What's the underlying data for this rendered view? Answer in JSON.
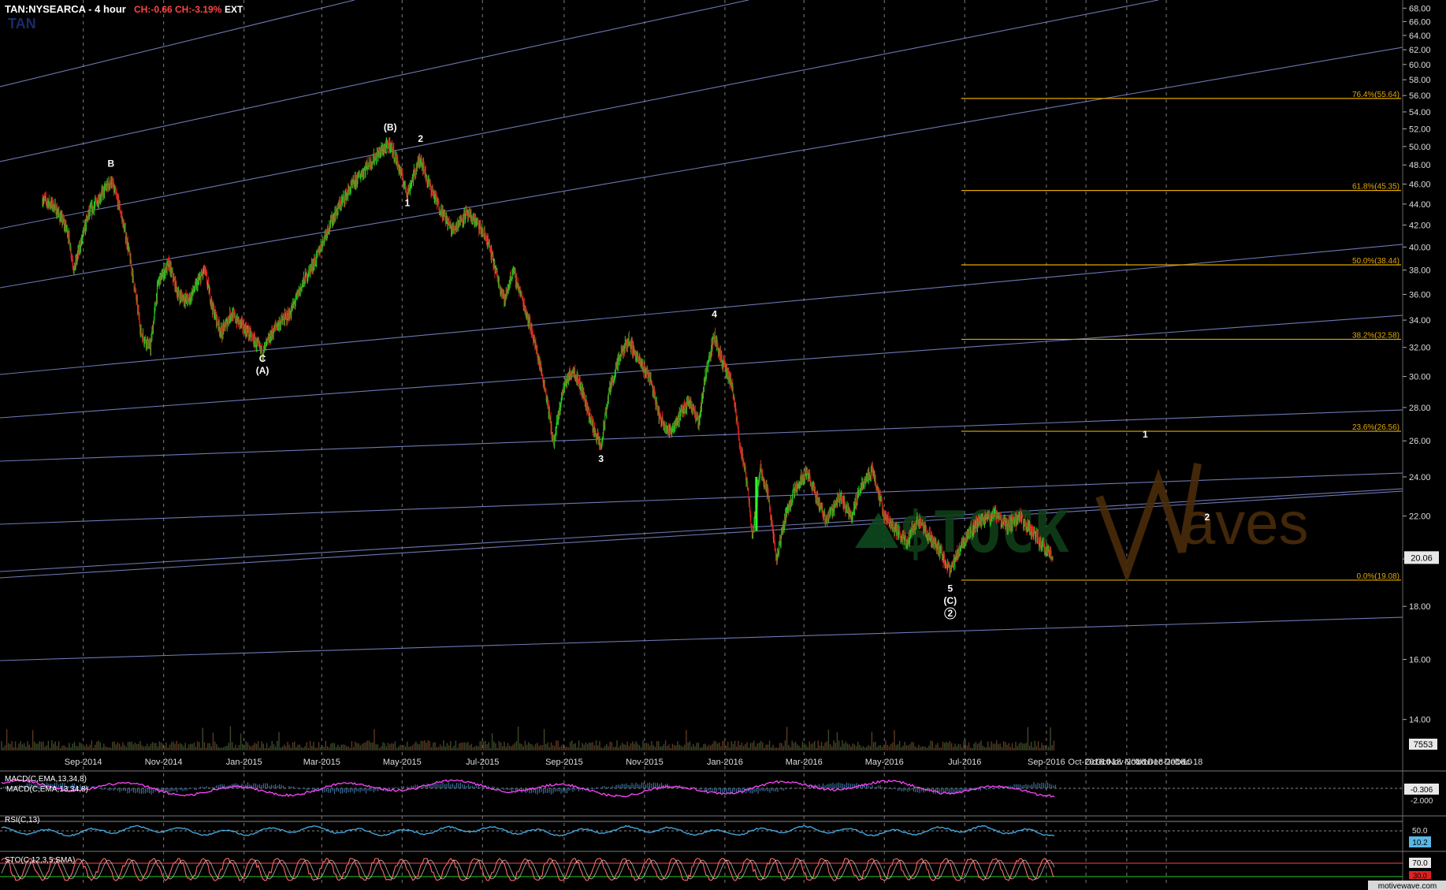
{
  "header": {
    "symbol": "TAN:NYSEARCA - 4 hour",
    "change": "CH:-0.66",
    "change_pct": "CH:-3.19%",
    "session": "EXT",
    "sub": "TAN"
  },
  "watermark": {
    "stock": "$TOCK",
    "waves": "Waves"
  },
  "footer": {
    "credit": "motivewave.com"
  },
  "colors": {
    "up": "#22cc22",
    "down": "#dd2222",
    "fib": "#e0a800",
    "channel": "#7a86c8",
    "macd": "#ff44ff",
    "signal": "#5ab8e8",
    "rsi": "#46aee8",
    "stoch_k": "#ff6a6a",
    "stoch_d": "#ffffff"
  },
  "chart_data": {
    "type": "candlestick",
    "symbol": "TAN",
    "timeframe": "4 hour",
    "y_scale": "log",
    "ylim": [
      13,
      69
    ],
    "y_ticks": [
      "14.00",
      "16.00",
      "18.00",
      "20.00",
      "22.00",
      "24.00",
      "26.00",
      "28.00",
      "30.00",
      "32.00",
      "34.00",
      "36.00",
      "38.00",
      "40.00",
      "42.00",
      "44.00",
      "46.00",
      "48.00",
      "50.00",
      "52.00",
      "54.00",
      "56.00",
      "58.00",
      "60.00",
      "62.00",
      "64.00",
      "66.00",
      "68.00"
    ],
    "last_price": "20.06",
    "volume_label": "7553",
    "x_ticks": [
      "Sep-2014",
      "Nov-2014",
      "Jan-2015",
      "Mar-2015",
      "May-2015",
      "Jul-2015",
      "Sep-2015",
      "Nov-2015",
      "Jan-2016",
      "Mar-2016",
      "May-2016",
      "Jul-2016",
      "Sep-2016",
      "Oct-2016",
      "Oct-10",
      "Oct-18",
      "Nov-2016",
      "Nov-10",
      "Nov-18",
      "Dec-2016",
      "Dec-10",
      "Dec-18"
    ],
    "price_path": [
      [
        "2014-08-01",
        44.5
      ],
      [
        "2014-08-10",
        43.8
      ],
      [
        "2014-08-20",
        41.5
      ],
      [
        "2014-08-25",
        38.0
      ],
      [
        "2014-09-05",
        43.0
      ],
      [
        "2014-09-15",
        45.0
      ],
      [
        "2014-09-22",
        46.3
      ],
      [
        "2014-09-28",
        44.0
      ],
      [
        "2014-10-05",
        40.0
      ],
      [
        "2014-10-15",
        33.0
      ],
      [
        "2014-10-22",
        32.0
      ],
      [
        "2014-10-28",
        37.0
      ],
      [
        "2014-11-05",
        38.5
      ],
      [
        "2014-11-12",
        36.0
      ],
      [
        "2014-11-20",
        35.5
      ],
      [
        "2014-12-02",
        38.0
      ],
      [
        "2014-12-08",
        35.0
      ],
      [
        "2014-12-15",
        33.0
      ],
      [
        "2014-12-22",
        34.5
      ],
      [
        "2015-01-05",
        33.0
      ],
      [
        "2015-01-15",
        31.6
      ],
      [
        "2015-01-25",
        33.5
      ],
      [
        "2015-02-05",
        34.5
      ],
      [
        "2015-02-15",
        37.0
      ],
      [
        "2015-02-25",
        39.0
      ],
      [
        "2015-03-05",
        41.5
      ],
      [
        "2015-03-15",
        44.0
      ],
      [
        "2015-03-25",
        46.0
      ],
      [
        "2015-04-05",
        48.0
      ],
      [
        "2015-04-15",
        49.5
      ],
      [
        "2015-04-22",
        50.2
      ],
      [
        "2015-04-28",
        48.0
      ],
      [
        "2015-05-05",
        45.0
      ],
      [
        "2015-05-10",
        47.0
      ],
      [
        "2015-05-15",
        48.8
      ],
      [
        "2015-05-20",
        46.5
      ],
      [
        "2015-05-28",
        44.0
      ],
      [
        "2015-06-08",
        41.5
      ],
      [
        "2015-06-18",
        43.0
      ],
      [
        "2015-06-25",
        42.5
      ],
      [
        "2015-07-05",
        40.5
      ],
      [
        "2015-07-12",
        37.5
      ],
      [
        "2015-07-18",
        35.5
      ],
      [
        "2015-07-24",
        38.0
      ],
      [
        "2015-07-30",
        36.0
      ],
      [
        "2015-08-08",
        33.0
      ],
      [
        "2015-08-18",
        29.0
      ],
      [
        "2015-08-24",
        25.8
      ],
      [
        "2015-09-01",
        29.5
      ],
      [
        "2015-09-08",
        30.5
      ],
      [
        "2015-09-15",
        29.0
      ],
      [
        "2015-09-22",
        27.0
      ],
      [
        "2015-09-29",
        25.6
      ],
      [
        "2015-10-05",
        29.0
      ],
      [
        "2015-10-14",
        31.5
      ],
      [
        "2015-10-20",
        32.5
      ],
      [
        "2015-10-28",
        31.0
      ],
      [
        "2015-11-05",
        30.0
      ],
      [
        "2015-11-12",
        27.5
      ],
      [
        "2015-11-20",
        26.5
      ],
      [
        "2015-11-28",
        27.5
      ],
      [
        "2015-12-05",
        28.5
      ],
      [
        "2015-12-12",
        27.0
      ],
      [
        "2015-12-18",
        30.5
      ],
      [
        "2015-12-24",
        32.8
      ],
      [
        "2015-12-30",
        31.0
      ],
      [
        "2016-01-06",
        29.5
      ],
      [
        "2016-01-12",
        26.0
      ],
      [
        "2016-01-18",
        23.5
      ],
      [
        "2016-01-22",
        21.0
      ],
      [
        "2016-01-28",
        24.5
      ],
      [
        "2016-02-03",
        23.0
      ],
      [
        "2016-02-09",
        19.9
      ],
      [
        "2016-02-16",
        22.0
      ],
      [
        "2016-02-24",
        23.5
      ],
      [
        "2016-03-03",
        24.3
      ],
      [
        "2016-03-10",
        23.0
      ],
      [
        "2016-03-18",
        21.8
      ],
      [
        "2016-03-28",
        23.0
      ],
      [
        "2016-04-06",
        22.0
      ],
      [
        "2016-04-14",
        23.6
      ],
      [
        "2016-04-22",
        24.4
      ],
      [
        "2016-05-01",
        22.0
      ],
      [
        "2016-05-10",
        21.3
      ],
      [
        "2016-05-18",
        20.8
      ],
      [
        "2016-05-26",
        21.8
      ],
      [
        "2016-06-04",
        21.0
      ],
      [
        "2016-06-12",
        20.4
      ],
      [
        "2016-06-20",
        19.4
      ],
      [
        "2016-06-27",
        20.5
      ],
      [
        "2016-07-05",
        21.3
      ],
      [
        "2016-07-14",
        21.8
      ],
      [
        "2016-07-24",
        22.1
      ],
      [
        "2016-08-02",
        21.5
      ],
      [
        "2016-08-12",
        21.9
      ],
      [
        "2016-08-22",
        21.2
      ],
      [
        "2016-08-30",
        20.6
      ],
      [
        "2016-09-06",
        20.06
      ]
    ],
    "fibonacci_levels": [
      {
        "label": "76.4%(55.64)",
        "value": 55.64
      },
      {
        "label": "61.8%(45.35)",
        "value": 45.35
      },
      {
        "label": "50.0%(38.44)",
        "value": 38.44
      },
      {
        "label": "38.2%(32.58)",
        "value": 32.58
      },
      {
        "label": "23.6%(26.56)",
        "value": 26.56
      },
      {
        "label": "0.0%(19.08)",
        "value": 19.08
      }
    ],
    "wave_labels": [
      {
        "text": "B",
        "date": "2014-09-22",
        "value": 47.8
      },
      {
        "text": "C",
        "date": "2015-01-15",
        "value": 31.0
      },
      {
        "text": "(A)",
        "date": "2015-01-15",
        "value": 30.2
      },
      {
        "text": "(B)",
        "date": "2015-04-22",
        "value": 51.8
      },
      {
        "text": "1",
        "date": "2015-05-05",
        "value": 43.8
      },
      {
        "text": "2",
        "date": "2015-05-15",
        "value": 50.5
      },
      {
        "text": "3",
        "date": "2015-09-29",
        "value": 24.8
      },
      {
        "text": "4",
        "date": "2015-12-24",
        "value": 34.2
      },
      {
        "text": "5",
        "date": "2016-06-20",
        "value": 18.6
      },
      {
        "text": "(C)",
        "date": "2016-06-20",
        "value": 18.1
      },
      {
        "text": "2",
        "date": "2016-06-20",
        "value": 17.6,
        "circled": true
      },
      {
        "text": "1",
        "date": "2016-11-15",
        "value": 26.2
      },
      {
        "text": "2",
        "date": "2017-01-01",
        "value": 21.8
      }
    ]
  },
  "indicators": {
    "macd": {
      "label1": "MACD(C,EMA,13,34,8)",
      "label2": "MACD(C,EMA,13,34,8)",
      "value": "-0.306",
      "tick": "-2.000"
    },
    "rsi": {
      "label": "RSI(C,13)",
      "value": "10.2",
      "tick": "50.0"
    },
    "stoch": {
      "label": "STO(C,12,3,5,SMA)",
      "upper": "70.0",
      "lower": "30.0"
    }
  }
}
